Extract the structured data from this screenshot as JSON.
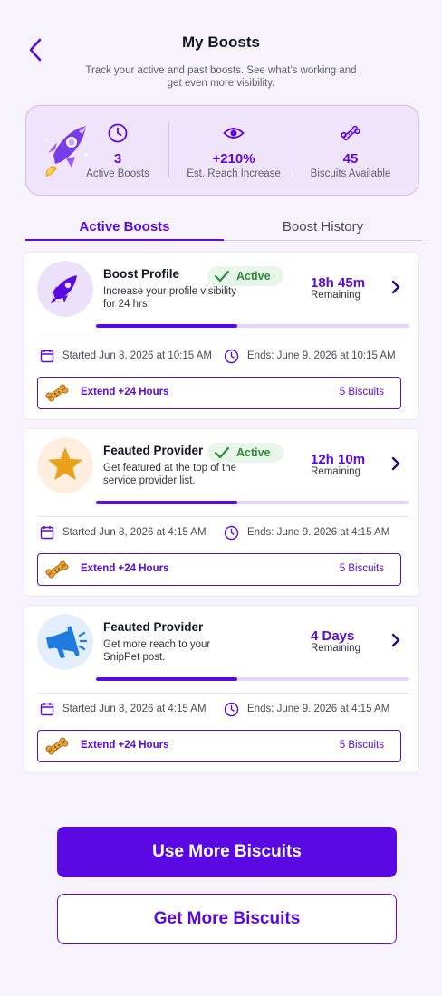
{
  "header": {
    "title": "My Boosts",
    "subtitle": "Track your active and past boosts. See what’s working and get even more visibility."
  },
  "stats": [
    {
      "icon": "clock-icon",
      "value": "3",
      "label": "Active Boosts"
    },
    {
      "icon": "eye-icon",
      "value": "+210%",
      "label": "Est. Reach Increase"
    },
    {
      "icon": "biscuit-icon",
      "value": "45",
      "label": "Biscuits Available"
    }
  ],
  "tabs": [
    {
      "label": "Active Boosts",
      "active": true
    },
    {
      "label": "Boost History",
      "active": false
    }
  ],
  "boosts": [
    {
      "icon": "rocket-icon",
      "name": "Boost Profile",
      "description": "Increase your profile visibility for 24 hrs.",
      "status": "Active",
      "time": "18h 45m",
      "remaining_label": "Remaining",
      "progress": 0.45,
      "started": "Started Jun 8, 2026 at 10:15 AM",
      "ends": "Ends: June 9. 2026 at 10:15 AM",
      "extend_label": "Extend +24 Hours",
      "extend_cost": "5 Biscuits"
    },
    {
      "icon": "star-icon",
      "name": "Feauted Provider",
      "description": "Get featured at the top of the service provider list.",
      "status": "Active",
      "time": "12h 10m",
      "remaining_label": "Remaining",
      "progress": 0.45,
      "started": "Started Jun 8, 2026 at 4:15 AM",
      "ends": "Ends: June 9. 2026 at 4:15 AM",
      "extend_label": "Extend +24 Hours",
      "extend_cost": "5 Biscuits"
    },
    {
      "icon": "megaphone-icon",
      "name": "Feauted Provider",
      "description": "Get more reach to your SnipPet post.",
      "status": "",
      "time": "4 Days",
      "remaining_label": "Remaining",
      "progress": 0.45,
      "started": "Started Jun 8, 2026 at 4:15 AM",
      "ends": "Ends: June 9. 2026 at 4:15 AM",
      "extend_label": "Extend +24 Hours",
      "extend_cost": "5 Biscuits"
    }
  ],
  "actions": {
    "primary": "Use More Biscuits",
    "secondary": "Get More Biscuits"
  },
  "colors": {
    "accent": "#5b09e3",
    "accent_light": "#e3d4fb",
    "success": "#2e8b3a",
    "background": "#f6f3fc"
  }
}
